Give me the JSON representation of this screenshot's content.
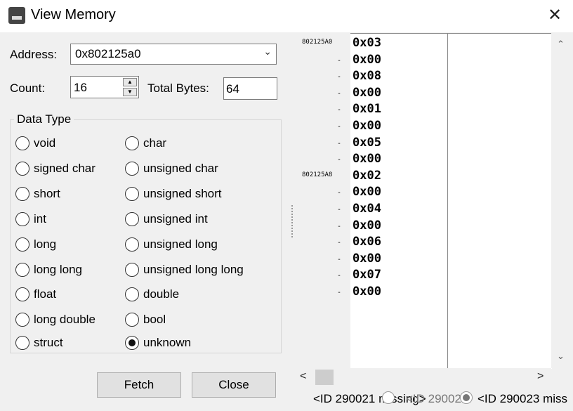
{
  "window": {
    "title": "View Memory"
  },
  "form": {
    "address_label": "Address:",
    "address_value": "0x802125a0",
    "count_label": "Count:",
    "count_value": "16",
    "total_label": "Total Bytes:",
    "total_value": "64"
  },
  "data_type": {
    "legend": "Data Type",
    "options": [
      "void",
      "char",
      "signed char",
      "unsigned char",
      "short",
      "unsigned short",
      "int",
      "unsigned int",
      "long",
      "unsigned long",
      "long long",
      "unsigned long long",
      "float",
      "double",
      "long double",
      "bool",
      "struct",
      "unknown"
    ],
    "selected": "unknown"
  },
  "buttons": {
    "fetch": "Fetch",
    "close": "Close"
  },
  "memory": {
    "addresses": [
      "802125A0",
      "802125A8"
    ],
    "dash": "-",
    "values": [
      "0x03",
      "0x00",
      "0x08",
      "0x00",
      "0x01",
      "0x00",
      "0x05",
      "0x00",
      "0x02",
      "0x00",
      "0x04",
      "0x00",
      "0x06",
      "0x00",
      "0x07",
      "0x00"
    ]
  },
  "status": {
    "text": "<ID 290021 missing>",
    "ghost": "<ID 29002",
    "tail": "<ID 290023 miss"
  },
  "icons": {
    "close": "close-icon",
    "chevron": "chevron-down-icon",
    "app": "app-icon"
  }
}
